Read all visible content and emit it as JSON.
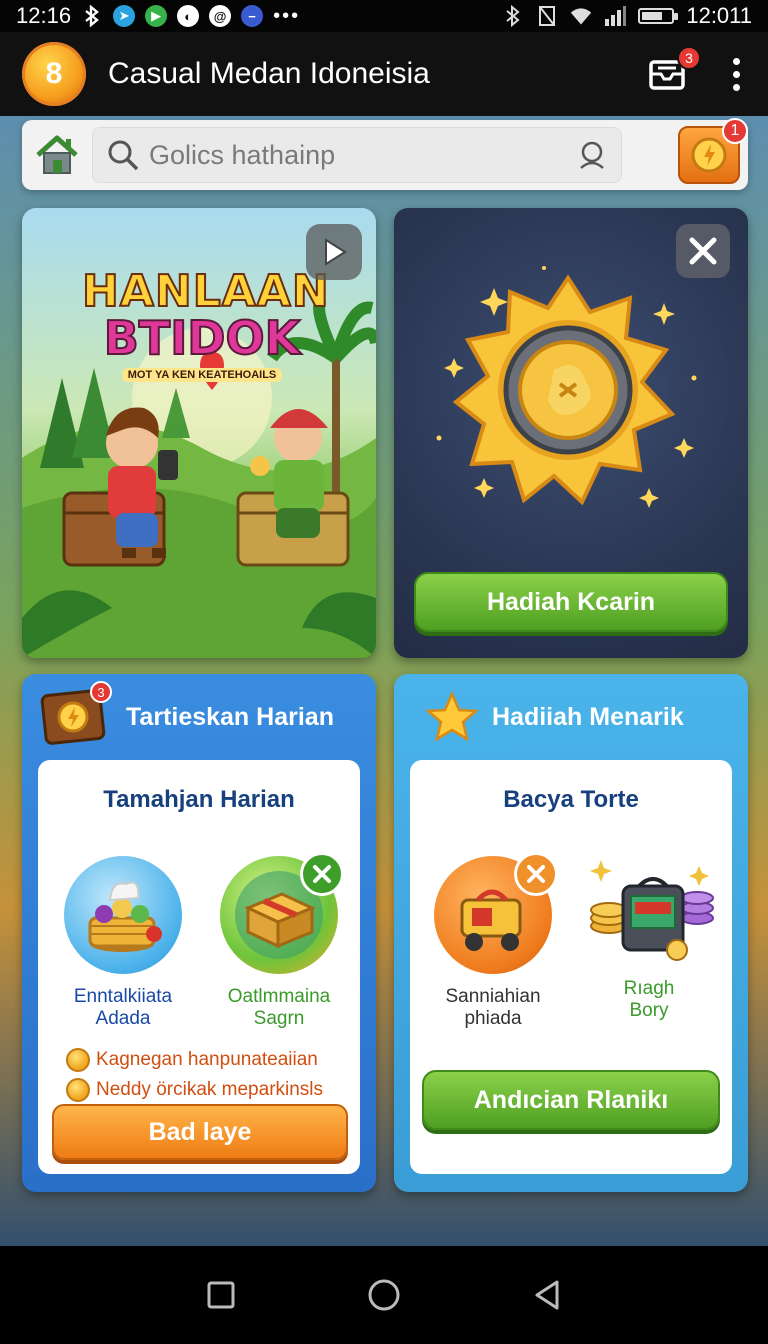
{
  "status_bar": {
    "time_left": "12:16",
    "time_right": "12:011",
    "badge_icons": [
      "bluetooth-icon",
      "telegram-icon",
      "play-icon",
      "speed-icon",
      "vpn-icon",
      "more-icon"
    ]
  },
  "app_bar": {
    "logo_text": "8",
    "title": "Casual Medan Idoneisia",
    "notification_count": "3"
  },
  "search": {
    "placeholder": "Golics hathainp",
    "reward_badge": "1"
  },
  "promo": {
    "title_line1": "HANLAAN",
    "title_line2": "BTIDOK",
    "subtitle": "MOT YA KEN KEATEHOAILS"
  },
  "reward": {
    "button_label": "Hadiah Kcarin"
  },
  "daily": {
    "header_title": "Tartieskan Harian",
    "header_badge": "3",
    "panel_title": "Tamahjan Harian",
    "items": [
      {
        "label_line1": "Enntalkiiata",
        "label_line2": "Adada"
      },
      {
        "label_line1": "Oatlmmaina",
        "label_line2": "Sagrn"
      }
    ],
    "bonus_lines": [
      "Kagnegan hanpunateaiian",
      "Neddy örcikak meparkinsls"
    ],
    "button_label": "Bad laye"
  },
  "special": {
    "header_title": "Hadiiah Menarik",
    "panel_title": "Bacya Torte",
    "items": [
      {
        "label_line1": "Sanniahian",
        "label_line2": "phiada"
      },
      {
        "label_line1": "Rıagh",
        "label_line2": "Bory"
      }
    ],
    "button_label": "Andıcian Rlanikı"
  },
  "colors": {
    "accent_green": "#5aa82a",
    "accent_orange": "#f08a1c",
    "daily_blue": "#2f7bd6",
    "special_blue": "#43aae2",
    "badge_red": "#e53935"
  }
}
